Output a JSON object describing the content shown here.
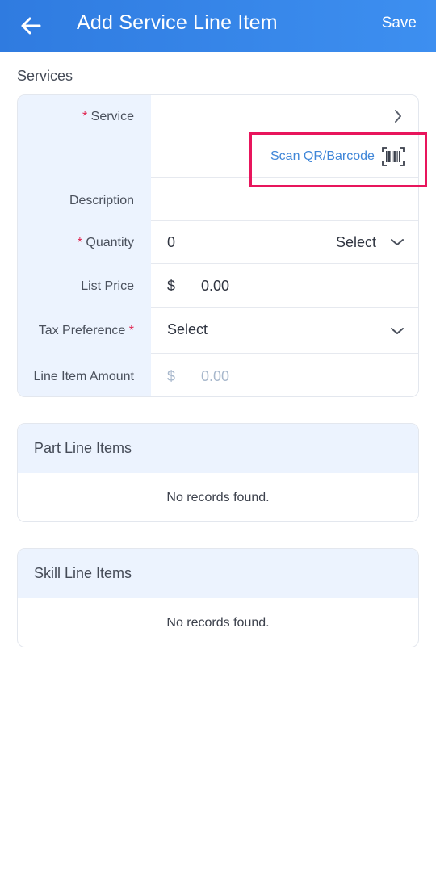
{
  "header": {
    "title": "Add Service Line Item",
    "save_label": "Save"
  },
  "services": {
    "section_title": "Services",
    "service": {
      "label": "Service",
      "required_mark": "*",
      "scan_label": "Scan QR/Barcode"
    },
    "description": {
      "label": "Description",
      "value": ""
    },
    "quantity": {
      "label": "Quantity",
      "required_mark": "*",
      "value": "0",
      "unit_placeholder": "Select"
    },
    "list_price": {
      "label": "List Price",
      "currency": "$",
      "value": "0.00"
    },
    "tax_preference": {
      "label": "Tax Preference",
      "required_mark": "*",
      "placeholder": "Select"
    },
    "line_item_amount": {
      "label": "Line Item Amount",
      "currency": "$",
      "value": "0.00"
    }
  },
  "part_line_items": {
    "title": "Part Line Items",
    "empty_text": "No records found."
  },
  "skill_line_items": {
    "title": "Skill Line Items",
    "empty_text": "No records found."
  },
  "colors": {
    "appbar": "#2f7be0",
    "accent_link": "#3f86d8",
    "required": "#e0224e",
    "highlight_border": "#e8155c",
    "label_bg": "#ecf3fe"
  }
}
